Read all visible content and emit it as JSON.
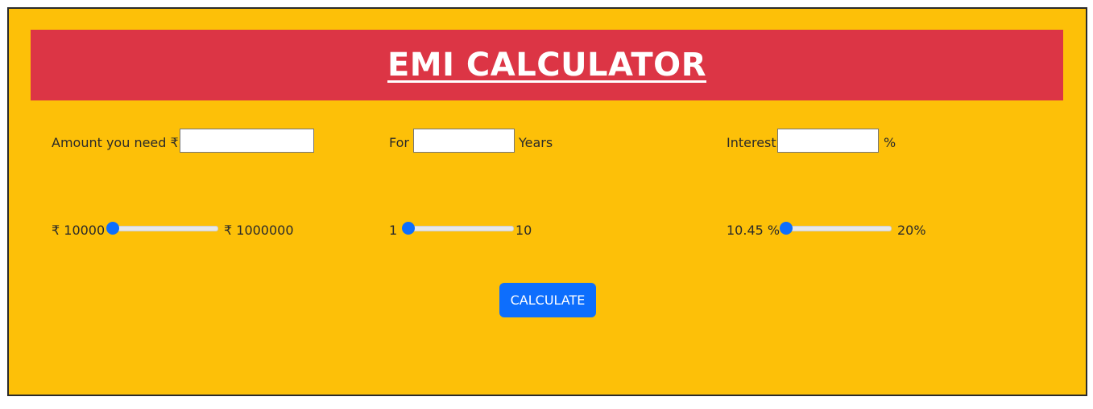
{
  "header": {
    "title": "EMI CALCULATOR"
  },
  "amount": {
    "label": "Amount you need ₹",
    "value": "",
    "min_label": "₹ 10000",
    "max_label": "₹ 1000000",
    "slider_fraction": 0.0
  },
  "years": {
    "prefix_label": "For",
    "suffix_label": "Years",
    "value": "",
    "min_label": "1",
    "max_label": "10",
    "slider_fraction": 0.0
  },
  "interest": {
    "label": "Interest",
    "suffix_label": "%",
    "value": "",
    "min_label": "10.45 %",
    "max_label": "20%",
    "slider_fraction": 0.0
  },
  "actions": {
    "calculate_label": "CALCULATE"
  },
  "colors": {
    "page_background": "#fdc008",
    "header_background": "#dc3545",
    "accent": "#0d6efd"
  }
}
